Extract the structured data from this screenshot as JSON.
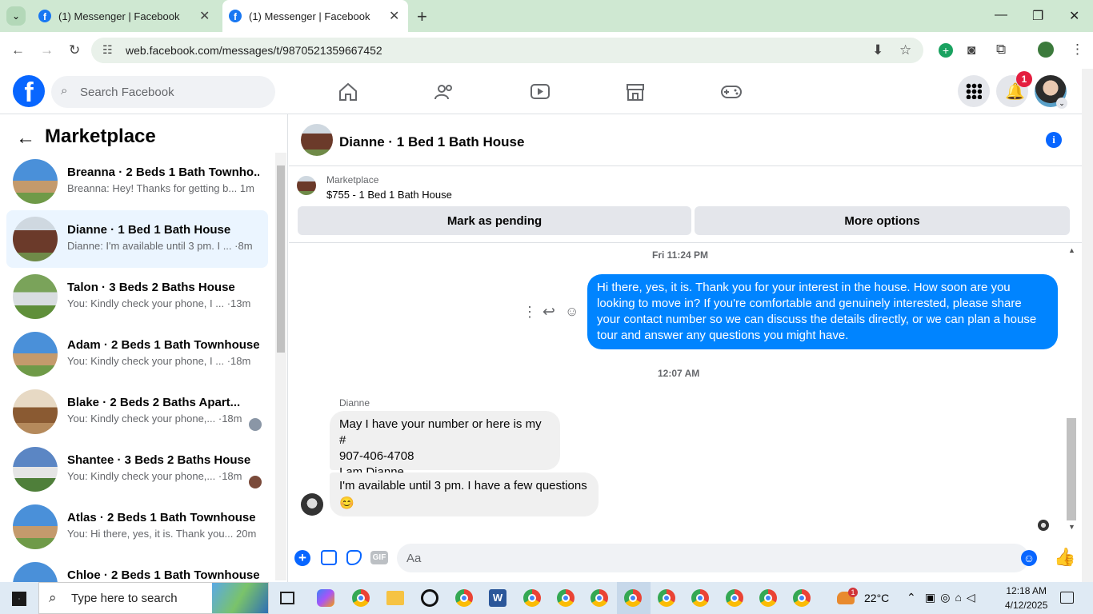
{
  "browser": {
    "tabs": [
      {
        "title": "(1) Messenger | Facebook",
        "favicon": "facebook-icon"
      },
      {
        "title": "(1) Messenger | Facebook",
        "favicon": "facebook-icon"
      }
    ],
    "url": "web.facebook.com/messages/t/9870521359667452"
  },
  "fb": {
    "search_placeholder": "Search Facebook",
    "notifications_count": "1"
  },
  "marketplace": {
    "title": "Marketplace",
    "conversations": [
      {
        "title": "Breanna · 2 Beds 1 Bath Townho...",
        "preview": "Breanna: Hey! Thanks for getting b...",
        "time": "1m"
      },
      {
        "title": "Dianne · 1 Bed 1 Bath House",
        "preview": "Dianne: I'm available until 3 pm. I ...",
        "time": "·8m"
      },
      {
        "title": "Talon · 3 Beds 2 Baths House",
        "preview": "You: Kindly check your phone, I ...",
        "time": "·13m"
      },
      {
        "title": "Adam · 2 Beds 1 Bath Townhouse",
        "preview": "You: Kindly check your phone, I ...",
        "time": "·18m"
      },
      {
        "title": "Blake · 2 Beds 2 Baths Apart...",
        "preview": "You: Kindly check your phone,...",
        "time": "·18m"
      },
      {
        "title": "Shantee · 3 Beds 2 Baths House",
        "preview": "You: Kindly check your phone,...",
        "time": "·18m"
      },
      {
        "title": "Atlas · 2 Beds 1 Bath Townhouse",
        "preview": "You: Hi there, yes, it is. Thank you...",
        "time": "20m"
      },
      {
        "title": "Chloe · 2 Beds 1 Bath Townhouse",
        "preview": "",
        "time": ""
      }
    ]
  },
  "chat": {
    "header": "Dianne · 1 Bed 1 Bath House",
    "listing_label": "Marketplace",
    "listing_title": "$755 - 1 Bed 1 Bath House",
    "pending_button": "Mark as pending",
    "more_button": "More options",
    "timestamp1": "Fri 11:24 PM",
    "outgoing": "Hi there, yes, it is. Thank you for your interest in the house. How soon are you looking to move in? If you're comfortable and genuinely interested, please share your contact number so we can discuss the details directly, or we can plan a house tour and answer any questions you might have.",
    "timestamp2": "12:07 AM",
    "sender": "Dianne",
    "incoming1_line1": "May I have your number or here is my #",
    "incoming1_line2": "907-406-4708",
    "incoming1_line3": "I am Dianne",
    "incoming2": "I'm available until 3 pm. I have a few questions",
    "incoming2_emoji": "😊",
    "input_placeholder": "Aa",
    "gif_label": "GIF"
  },
  "taskbar": {
    "search_placeholder": "Type here to search",
    "weather": "22°C",
    "weather_badge": "1",
    "time": "12:18 AM",
    "date": "4/12/2025"
  },
  "colors": {
    "fb_blue": "#0866ff",
    "bubble_blue": "#0084ff",
    "active_conv": "#ebf5ff"
  }
}
